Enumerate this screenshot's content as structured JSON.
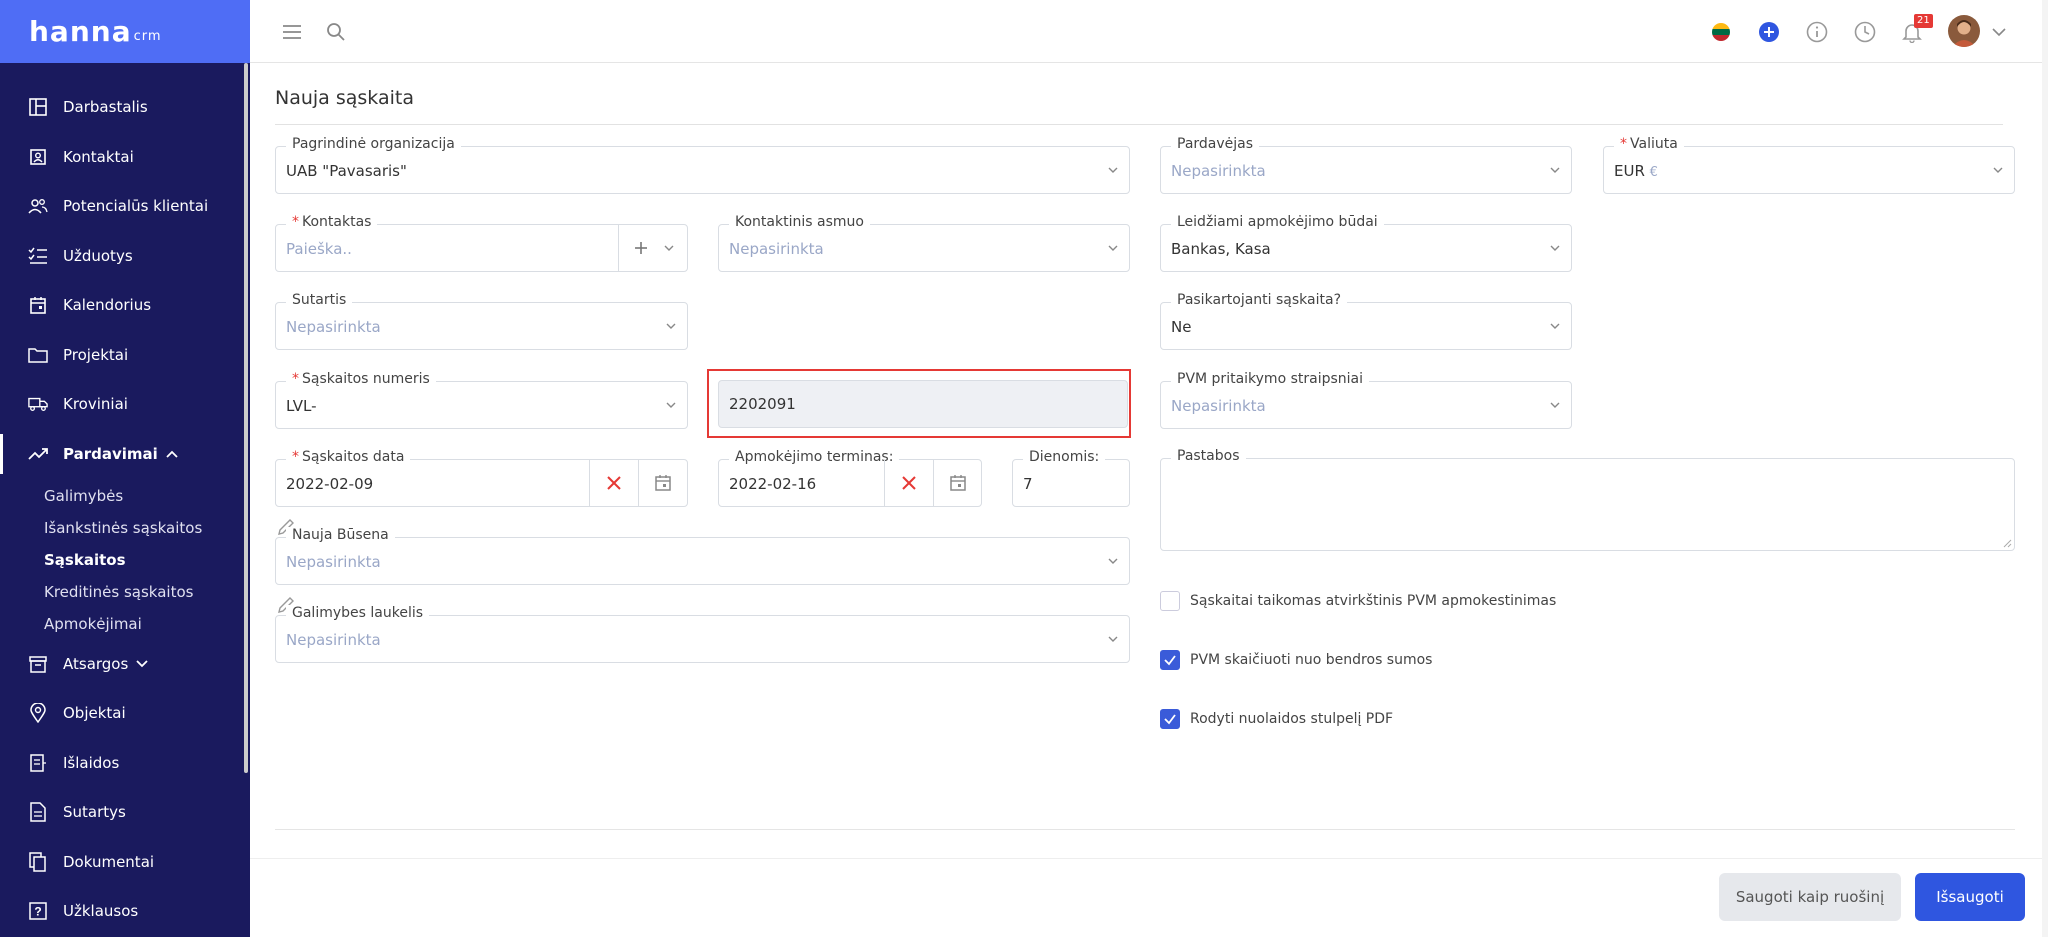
{
  "brand": {
    "name": "hanna",
    "suffix": "crm"
  },
  "sidebar": {
    "items": [
      {
        "label": "Darbastalis",
        "icon": "dashboard-icon"
      },
      {
        "label": "Kontaktai",
        "icon": "contacts-icon"
      },
      {
        "label": "Potencialūs klientai",
        "icon": "users-icon"
      },
      {
        "label": "Užduotys",
        "icon": "tasks-icon"
      },
      {
        "label": "Kalendorius",
        "icon": "calendar-icon"
      },
      {
        "label": "Projektai",
        "icon": "folder-icon"
      },
      {
        "label": "Kroviniai",
        "icon": "truck-icon"
      },
      {
        "label": "Pardavimai",
        "icon": "trend-icon"
      },
      {
        "label": "Atsargos",
        "icon": "archive-icon"
      },
      {
        "label": "Objektai",
        "icon": "location-icon"
      },
      {
        "label": "Išlaidos",
        "icon": "receipt-icon"
      },
      {
        "label": "Sutartys",
        "icon": "contract-icon"
      },
      {
        "label": "Dokumentai",
        "icon": "documents-icon"
      },
      {
        "label": "Užklausos",
        "icon": "question-icon"
      }
    ],
    "sub_items": [
      {
        "label": "Galimybės"
      },
      {
        "label": "Išankstinės sąskaitos"
      },
      {
        "label": "Sąskaitos"
      },
      {
        "label": "Kreditinės sąskaitos"
      },
      {
        "label": "Apmokėjimai"
      }
    ]
  },
  "topbar": {
    "notification_count": "21",
    "colors": {
      "accent": "#2f56e0",
      "badge": "#e53935"
    }
  },
  "page": {
    "title": "Nauja sąskaita"
  },
  "form": {
    "org": {
      "label": "Pagrindinė organizacija",
      "value": "UAB \"Pavasaris\""
    },
    "seller": {
      "label": "Pardavėjas",
      "value": "Nepasirinkta"
    },
    "currency": {
      "label": "Valiuta",
      "value": "EUR",
      "symbol": "€"
    },
    "contact": {
      "label": "Kontaktas",
      "placeholder": "Paieška.."
    },
    "contact_person": {
      "label": "Kontaktinis asmuo",
      "value": "Nepasirinkta"
    },
    "payment_methods": {
      "label": "Leidžiami apmokėjimo būdai",
      "value": "Bankas, Kasa"
    },
    "contract": {
      "label": "Sutartis",
      "value": "Nepasirinkta"
    },
    "recurring": {
      "label": "Pasikartojanti sąskaita?",
      "value": "Ne"
    },
    "invoice_series": {
      "label": "Sąskaitos numeris",
      "value": "LVL-"
    },
    "invoice_number": {
      "value": "2202091"
    },
    "vat_articles": {
      "label": "PVM pritaikymo straipsniai",
      "value": "Nepasirinkta"
    },
    "invoice_date": {
      "label": "Sąskaitos data",
      "value": "2022-02-09"
    },
    "due_date": {
      "label": "Apmokėjimo terminas:",
      "value": "2022-02-16"
    },
    "days": {
      "label": "Dienomis:",
      "value": "7"
    },
    "notes": {
      "label": "Pastabos"
    },
    "new_status": {
      "label": "Nauja Būsena",
      "value": "Nepasirinkta"
    },
    "opportunity_field": {
      "label": "Galimybes laukelis",
      "value": "Nepasirinkta"
    },
    "checks": [
      {
        "label": "Sąskaitai taikomas atvirkštinis PVM apmokestinimas",
        "checked": false
      },
      {
        "label": "PVM skaičiuoti nuo bendros sumos",
        "checked": true
      },
      {
        "label": "Rodyti nuolaidos stulpelį PDF",
        "checked": true
      }
    ]
  },
  "buttons": {
    "draft": "Saugoti kaip ruošinį",
    "save": "Išsaugoti"
  }
}
